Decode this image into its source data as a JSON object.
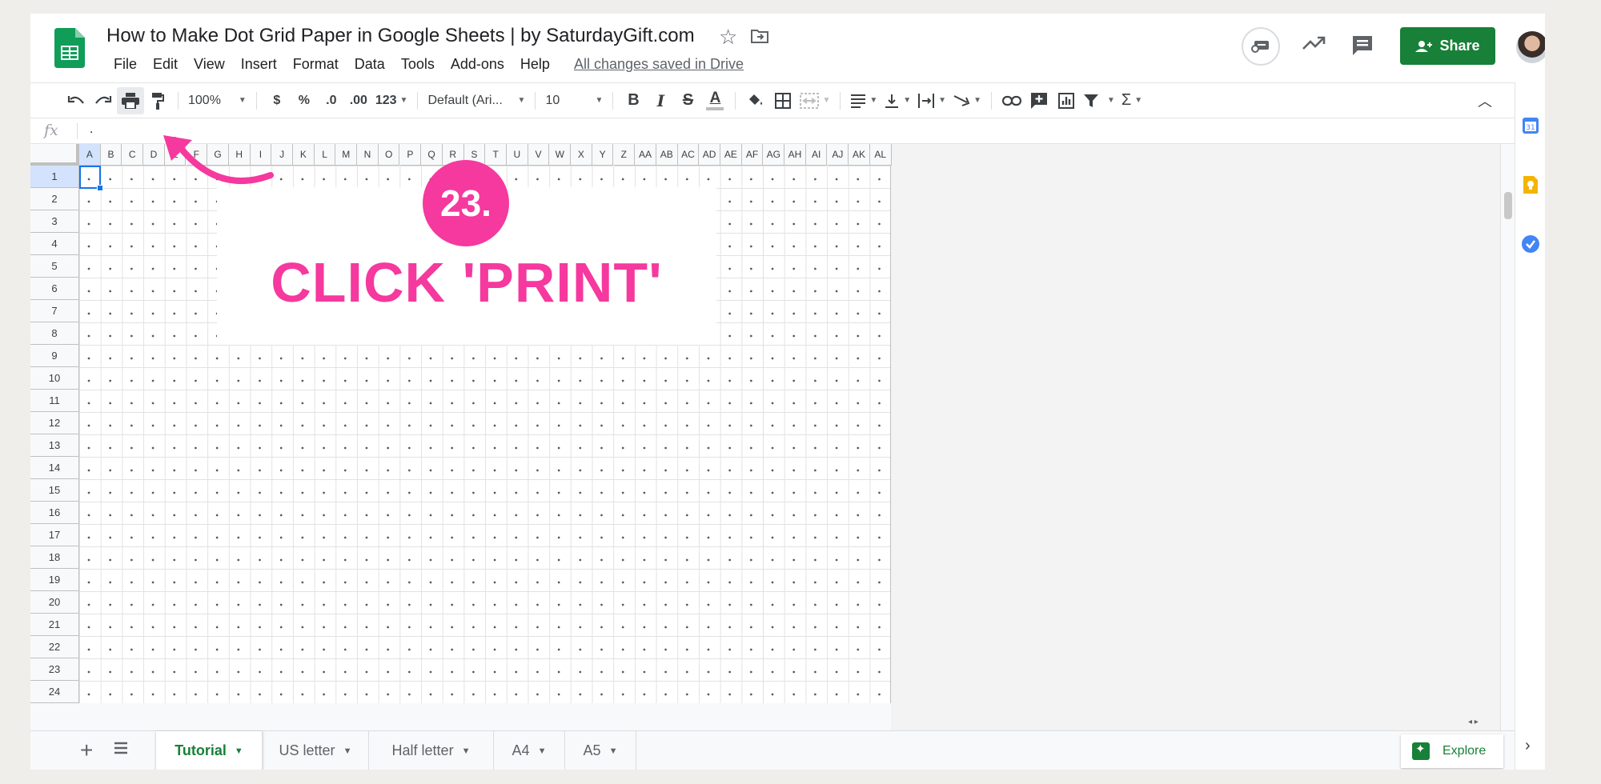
{
  "title_bar": {
    "doc_title": "How to Make Dot Grid Paper in Google Sheets | by SaturdayGift.com",
    "menu": [
      "File",
      "Edit",
      "View",
      "Insert",
      "Format",
      "Data",
      "Tools",
      "Add-ons",
      "Help"
    ],
    "saved_status": "All changes saved in Drive",
    "share_label": "Share"
  },
  "toolbar": {
    "zoom": "100%",
    "currency": "$",
    "percent": "%",
    "decrease_decimals": ".0",
    "increase_decimals": ".00",
    "more_formats": "123",
    "font": "Default (Ari...",
    "font_size": "10",
    "bold": "B",
    "italic": "I",
    "strikethrough": "S",
    "text_color": "A",
    "sum": "Σ"
  },
  "formula_bar": {
    "fx": "fx",
    "value": "."
  },
  "columns": [
    "A",
    "B",
    "C",
    "D",
    "E",
    "F",
    "G",
    "H",
    "I",
    "J",
    "K",
    "L",
    "M",
    "N",
    "O",
    "P",
    "Q",
    "R",
    "S",
    "T",
    "U",
    "V",
    "W",
    "X",
    "Y",
    "Z",
    "AA",
    "AB",
    "AC",
    "AD",
    "AE",
    "AF",
    "AG",
    "AH",
    "AI",
    "AJ",
    "AK",
    "AL"
  ],
  "rows": [
    "1",
    "2",
    "3",
    "4",
    "5",
    "6",
    "7",
    "8",
    "9",
    "10",
    "11",
    "12",
    "13",
    "14",
    "15",
    "16",
    "17",
    "18",
    "19",
    "20",
    "21",
    "22",
    "23",
    "24"
  ],
  "callout": {
    "step": "23.",
    "text": "CLICK 'PRINT'"
  },
  "sheets": {
    "tabs": [
      {
        "label": "Tutorial",
        "active": true
      },
      {
        "label": "US letter",
        "active": false
      },
      {
        "label": "Half letter",
        "active": false
      },
      {
        "label": "A4",
        "active": false
      },
      {
        "label": "A5",
        "active": false
      }
    ],
    "explore_label": "Explore"
  },
  "colors": {
    "accent": "#188038",
    "callout": "#f5399e",
    "selection": "#1a73e8"
  }
}
